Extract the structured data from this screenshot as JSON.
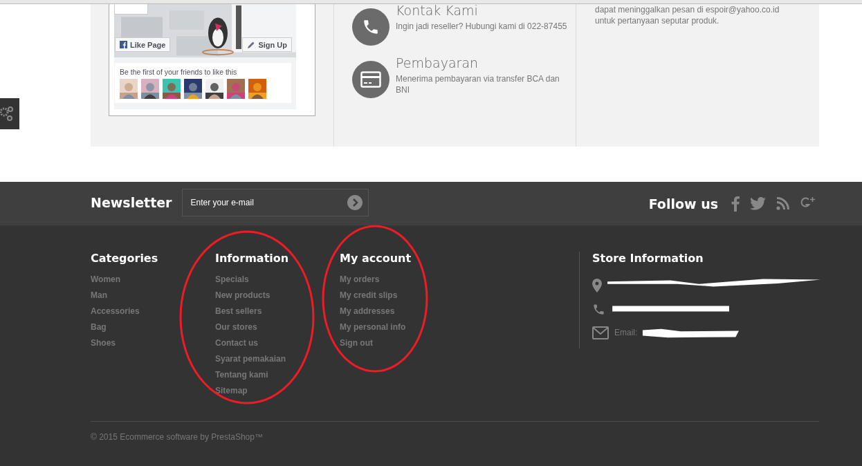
{
  "facebook_widget": {
    "like_button": "Like Page",
    "signup_button": "Sign Up",
    "friends_text": "Be the first of your friends to like this"
  },
  "info_items": [
    {
      "kind": "phone",
      "title": "Kontak Kami",
      "text": "Ingin jadi reseller? Hubungi kami di 022-87455"
    },
    {
      "kind": "card",
      "title": "Pembayaran",
      "text": "Menerima pembayaran via transfer BCA dan BNI"
    }
  ],
  "contact_note": [
    "dapat meninggalkan pesan di espoir@yahoo.co.id",
    "untuk pertanyaan seputar produk."
  ],
  "newsletter": {
    "title": "Newsletter",
    "placeholder": "Enter your e-mail"
  },
  "follow": {
    "title": "Follow us",
    "networks": [
      {
        "kind": "facebook"
      },
      {
        "kind": "twitter"
      },
      {
        "kind": "rss"
      },
      {
        "kind": "googleplus"
      }
    ]
  },
  "footer_columns": [
    {
      "title": "Categories",
      "links": [
        "Women",
        "Man",
        "Accessories",
        "Bag",
        "Shoes"
      ]
    },
    {
      "title": "Information",
      "links": [
        "Specials",
        "New products",
        "Best sellers",
        "Our stores",
        "Contact us",
        "Syarat pemakaian",
        "Tentang kami",
        "Sitemap"
      ]
    },
    {
      "title": "My account",
      "links": [
        "My orders",
        "My credit slips",
        "My addresses",
        "My personal info",
        "Sign out"
      ]
    }
  ],
  "store_info": {
    "title": "Store Information",
    "rows": [
      {
        "kind": "address"
      },
      {
        "kind": "phone"
      },
      {
        "kind": "email",
        "text": "Email:"
      }
    ]
  },
  "copyright": "© 2015 Ecommerce software by PrestaShop™"
}
